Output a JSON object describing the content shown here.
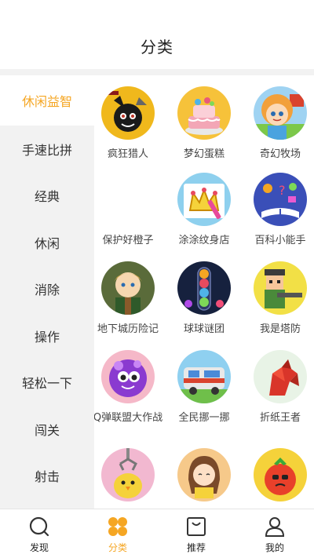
{
  "header": {
    "title": "分类"
  },
  "sidebar": {
    "active_index": 0,
    "items": [
      {
        "label": "休闲益智"
      },
      {
        "label": "手速比拼"
      },
      {
        "label": "经典"
      },
      {
        "label": "休闲"
      },
      {
        "label": "消除"
      },
      {
        "label": "操作"
      },
      {
        "label": "轻松一下"
      },
      {
        "label": "闯关"
      },
      {
        "label": "射击"
      }
    ]
  },
  "games": [
    {
      "name": "疯狂猎人",
      "icon": "stick-figure-hunter-icon"
    },
    {
      "name": "梦幻蛋糕",
      "icon": "cake-icon"
    },
    {
      "name": "奇幻牧场",
      "icon": "farm-girl-icon"
    },
    {
      "name": "保护好橙子",
      "icon": ""
    },
    {
      "name": "涂涂纹身店",
      "icon": "crown-drawing-icon"
    },
    {
      "name": "百科小能手",
      "icon": "encyclopedia-book-icon"
    },
    {
      "name": "地下城历险记",
      "icon": "elf-warrior-icon"
    },
    {
      "name": "球球谜团",
      "icon": "ball-tube-icon"
    },
    {
      "name": "我是塔防",
      "icon": "blocky-soldier-icon"
    },
    {
      "name": "Q弹联盟大作战",
      "icon": "purple-blob-icon"
    },
    {
      "name": "全民挪一挪",
      "icon": "train-icon"
    },
    {
      "name": "折纸王者",
      "icon": "origami-rooster-icon"
    },
    {
      "name": "",
      "icon": "claw-chick-icon"
    },
    {
      "name": "",
      "icon": "girl-reading-icon"
    },
    {
      "name": "",
      "icon": "angry-tomato-icon"
    }
  ],
  "tabbar": {
    "active_index": 1,
    "items": [
      {
        "label": "发现",
        "icon": "discover-icon"
      },
      {
        "label": "分类",
        "icon": "category-icon"
      },
      {
        "label": "推荐",
        "icon": "recommend-bag-icon"
      },
      {
        "label": "我的",
        "icon": "profile-icon"
      }
    ]
  },
  "colors": {
    "accent": "#f5a623",
    "sidebar_bg": "#f2f2f2"
  }
}
